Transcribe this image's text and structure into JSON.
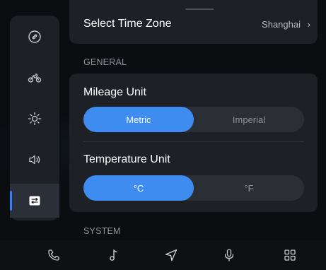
{
  "rail": {
    "items": [
      {
        "icon": "link-icon",
        "label": ""
      },
      {
        "icon": "motorcycle-icon",
        "label": ""
      },
      {
        "icon": "brightness-icon",
        "label": ""
      },
      {
        "icon": "volume-icon",
        "label": ""
      },
      {
        "icon": "display-settings-icon",
        "label": "",
        "active": true
      }
    ]
  },
  "time_zone": {
    "title": "Select Time Zone",
    "value": "Shanghai",
    "chevron": "›"
  },
  "sections": {
    "general": "GENERAL",
    "system": "SYSTEM"
  },
  "mileage": {
    "title": "Mileage Unit",
    "options": [
      "Metric",
      "Imperial"
    ],
    "selected": "Metric"
  },
  "temperature": {
    "title": "Temperature Unit",
    "options": [
      "°C",
      "°F"
    ],
    "selected": "°C"
  },
  "bottom_nav": {
    "items": [
      {
        "icon": "phone-icon"
      },
      {
        "icon": "music-note-icon"
      },
      {
        "icon": "navigation-icon"
      },
      {
        "icon": "microphone-icon"
      },
      {
        "icon": "apps-grid-icon"
      }
    ]
  },
  "colors": {
    "accent": "#3f8cf0",
    "active_indicator": "#2f80ff",
    "card_bg": "#1d2025",
    "page_bg": "#0b0d11"
  }
}
